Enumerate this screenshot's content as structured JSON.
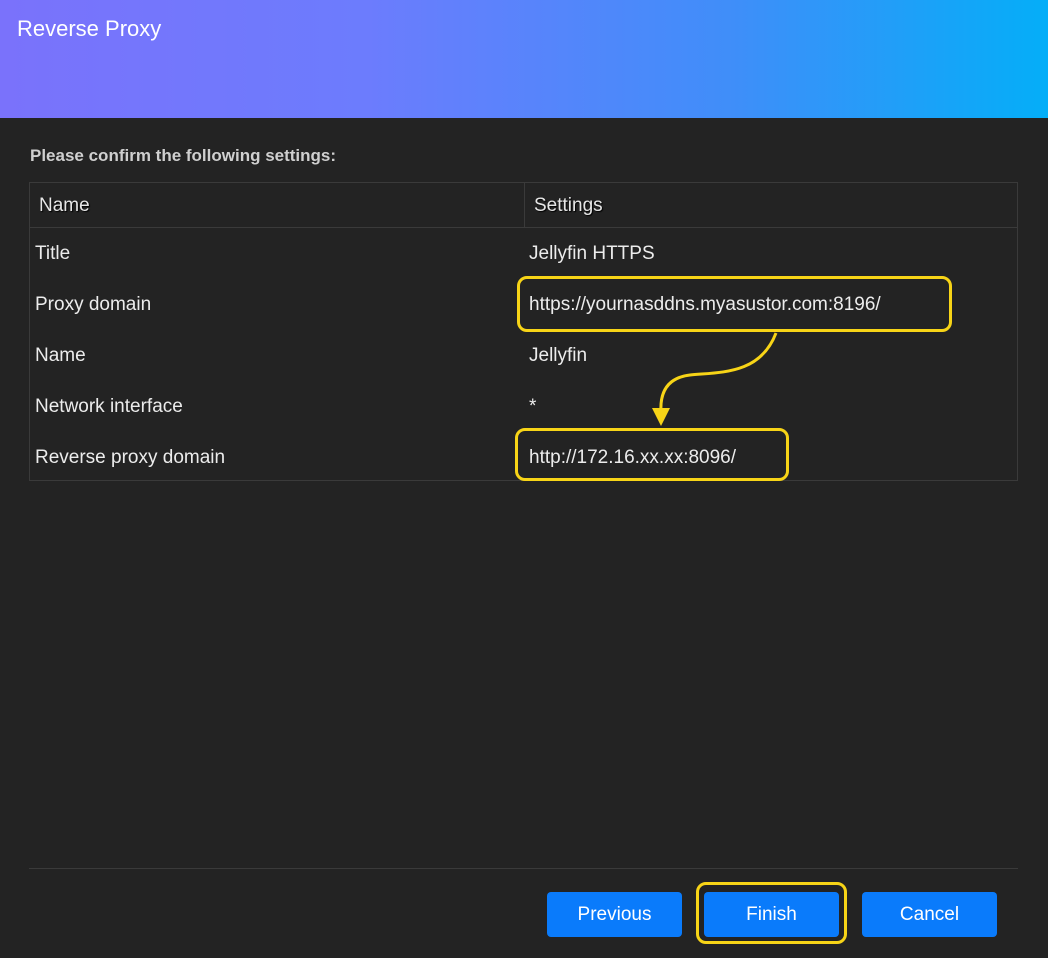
{
  "header": {
    "title": "Reverse Proxy"
  },
  "subtitle": "Please confirm the following settings:",
  "table": {
    "columns": [
      "Name",
      "Settings"
    ],
    "rows": [
      {
        "name": "Title",
        "value": "Jellyfin HTTPS"
      },
      {
        "name": "Proxy domain",
        "value": "https://yournasddns.myasustor.com:8196/"
      },
      {
        "name": "Name",
        "value": "Jellyfin"
      },
      {
        "name": "Network interface",
        "value": "*"
      },
      {
        "name": "Reverse proxy domain",
        "value": "http://172.16.xx.xx:8096/"
      }
    ]
  },
  "buttons": {
    "previous": "Previous",
    "finish": "Finish",
    "cancel": "Cancel"
  },
  "colors": {
    "accent": "#0a7bfb",
    "highlight": "#f7d417",
    "background": "#232323"
  }
}
